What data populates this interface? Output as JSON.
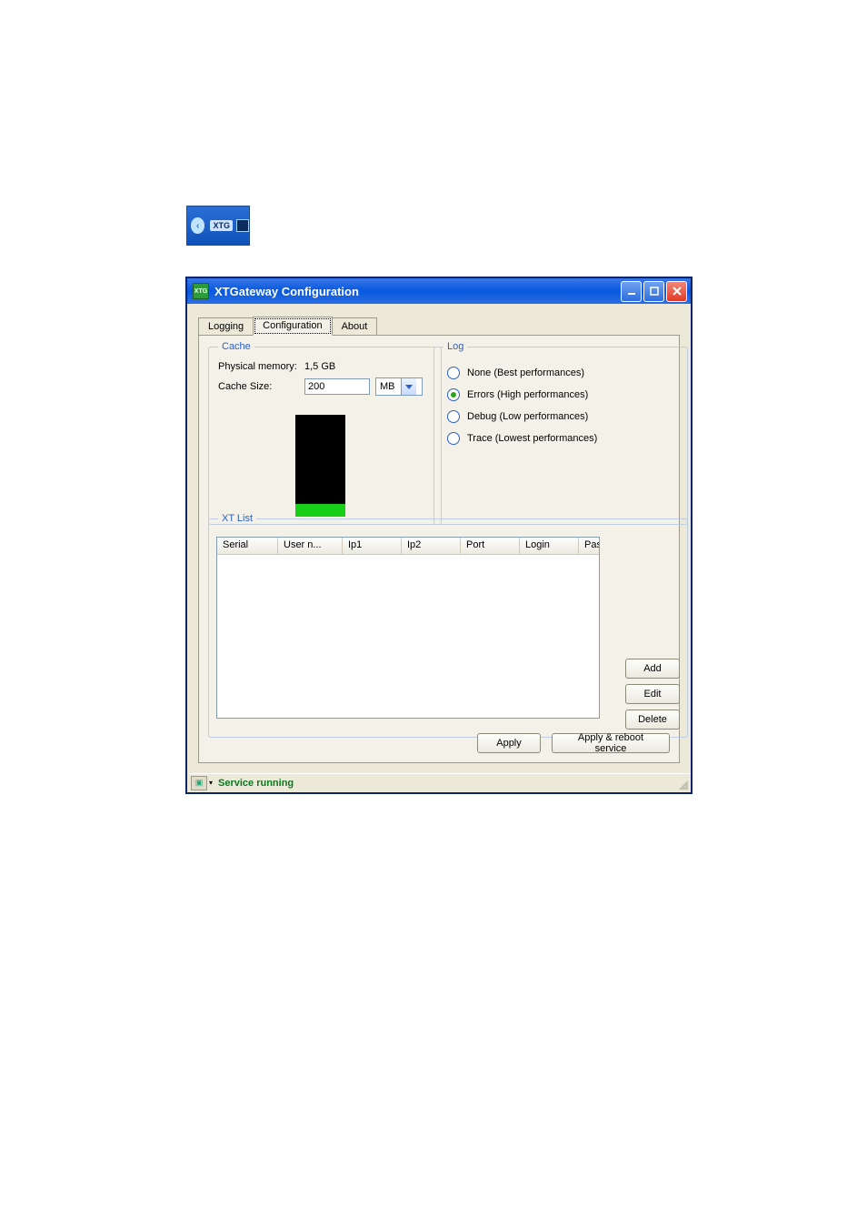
{
  "tray": {
    "label": "XTG"
  },
  "window": {
    "title": "XTGateway Configuration"
  },
  "tabs": {
    "items": [
      "Logging",
      "Configuration",
      "About"
    ],
    "active_index": 1
  },
  "cache": {
    "legend": "Cache",
    "physical_memory_label": "Physical memory:",
    "physical_memory_value": "1,5 GB",
    "cache_size_label": "Cache Size:",
    "cache_size_value": "200",
    "cache_size_unit": "MB"
  },
  "log": {
    "legend": "Log",
    "options": [
      "None (Best performances)",
      "Errors (High performances)",
      "Debug (Low performances)",
      "Trace (Lowest performances)"
    ],
    "selected_index": 1
  },
  "xtlist": {
    "legend": "XT List",
    "columns": [
      "Serial",
      "User n...",
      "Ip1",
      "Ip2",
      "Port",
      "Login",
      "Passw..."
    ],
    "buttons": {
      "add": "Add",
      "edit": "Edit",
      "delete": "Delete"
    }
  },
  "footer": {
    "apply": "Apply",
    "apply_reboot": "Apply & reboot service"
  },
  "status": {
    "text": "Service running"
  }
}
